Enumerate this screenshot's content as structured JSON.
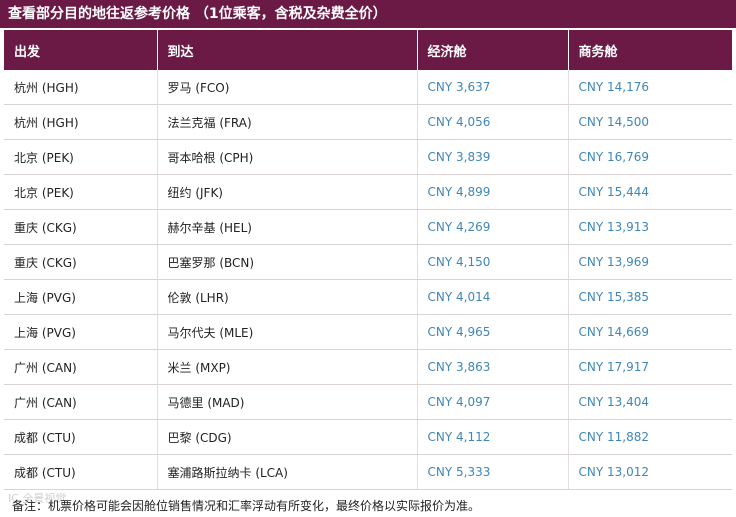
{
  "title": "查看部分目的地往返参考价格 （1位乘客，含税及杂费全价）",
  "headers": [
    "出发",
    "到达",
    "经济舱",
    "商务舱"
  ],
  "rows": [
    [
      "杭州 (HGH)",
      "罗马 (FCO)",
      "CNY 3,637",
      "CNY 14,176"
    ],
    [
      "杭州 (HGH)",
      "法兰克福 (FRA)",
      "CNY 4,056",
      "CNY 14,500"
    ],
    [
      "北京 (PEK)",
      "哥本哈根 (CPH)",
      "CNY 3,839",
      "CNY 16,769"
    ],
    [
      "北京 (PEK)",
      "纽约 (JFK)",
      "CNY 4,899",
      "CNY 15,444"
    ],
    [
      "重庆 (CKG)",
      "赫尔辛基 (HEL)",
      "CNY 4,269",
      "CNY 13,913"
    ],
    [
      "重庆 (CKG)",
      "巴塞罗那 (BCN)",
      "CNY 4,150",
      "CNY 13,969"
    ],
    [
      "上海 (PVG)",
      "伦敦 (LHR)",
      "CNY 4,014",
      "CNY 15,385"
    ],
    [
      "上海 (PVG)",
      "马尔代夫 (MLE)",
      "CNY 4,965",
      "CNY 14,669"
    ],
    [
      "广州 (CAN)",
      "米兰 (MXP)",
      "CNY 3,863",
      "CNY 17,917"
    ],
    [
      "广州 (CAN)",
      "马德里 (MAD)",
      "CNY 4,097",
      "CNY 13,404"
    ],
    [
      "成都 (CTU)",
      "巴黎 (CDG)",
      "CNY 4,112",
      "CNY 11,882"
    ],
    [
      "成都 (CTU)",
      "塞浦路斯拉纳卡 (LCA)",
      "CNY 5,333",
      "CNY 13,012"
    ]
  ],
  "note": "备注：机票价格可能会因舱位销售情况和汇率浮动有所变化，最终价格以实际报价为准。",
  "watermark": "IC 全景视觉",
  "colors": {
    "header_bg": "#6a1a45",
    "price_text": "#3f86b8",
    "row_border": "#d9d3d6"
  }
}
